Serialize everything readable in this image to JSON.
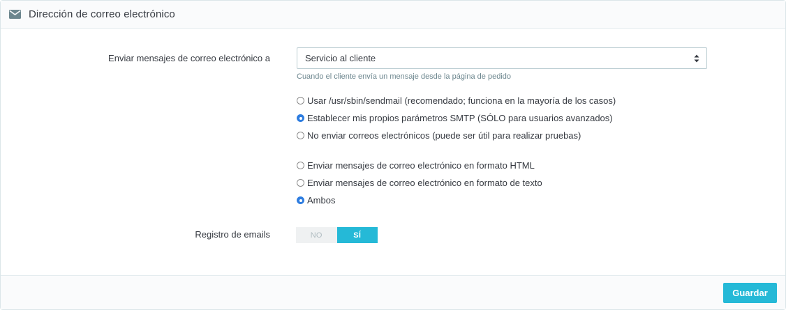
{
  "panel": {
    "title": "Dirección de correo electrónico",
    "icon": "envelope-icon"
  },
  "send_to": {
    "label": "Enviar mensajes de correo electrónico a",
    "selected": "Servicio al cliente",
    "help": "Cuando el cliente envía un mensaje desde la página de pedido"
  },
  "mail_method": {
    "options": [
      {
        "label": "Usar /usr/sbin/sendmail (recomendado; funciona en la mayoría de los casos)",
        "checked": false
      },
      {
        "label": "Establecer mis propios parámetros SMTP (SÓLO para usuarios avanzados)",
        "checked": true
      },
      {
        "label": "No enviar correos electrónicos (puede ser útil para realizar pruebas)",
        "checked": false
      }
    ]
  },
  "mail_format": {
    "options": [
      {
        "label": "Enviar mensajes de correo electrónico en formato HTML",
        "checked": false
      },
      {
        "label": "Enviar mensajes de correo electrónico en formato de texto",
        "checked": false
      },
      {
        "label": "Ambos",
        "checked": true
      }
    ]
  },
  "email_log": {
    "label": "Registro de emails",
    "off_label": "NO",
    "on_label": "SÍ",
    "value": true
  },
  "footer": {
    "save_label": "Guardar"
  },
  "colors": {
    "accent": "#25b9d7",
    "radio_checked": "#2e7de0",
    "text": "#363a41",
    "help_text": "#6c868e"
  }
}
